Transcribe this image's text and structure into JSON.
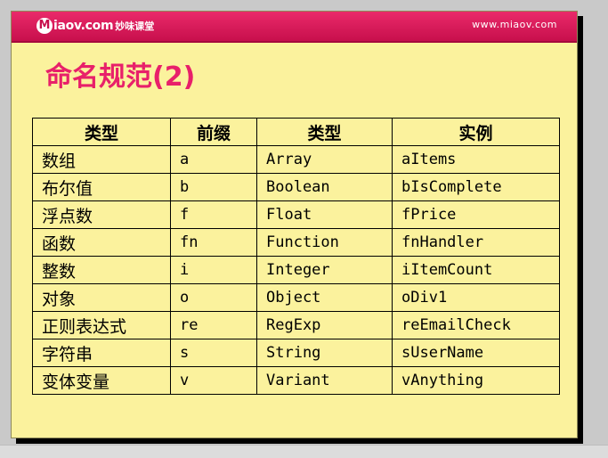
{
  "header": {
    "logo_badge": "M",
    "logo_text": "iaov.com",
    "logo_cn": "妙味课堂",
    "site_url": "www.miaov.com"
  },
  "slide": {
    "title": "命名规范(2)"
  },
  "table": {
    "headers": [
      "类型",
      "前缀",
      "类型",
      "实例"
    ],
    "rows": [
      [
        "数组",
        "a",
        "Array",
        "aItems"
      ],
      [
        "布尔值",
        "b",
        "Boolean",
        "bIsComplete"
      ],
      [
        "浮点数",
        "f",
        "Float",
        "fPrice"
      ],
      [
        "函数",
        "fn",
        "Function",
        "fnHandler"
      ],
      [
        "整数",
        "i",
        "Integer",
        "iItemCount"
      ],
      [
        "对象",
        "o",
        "Object",
        "oDiv1"
      ],
      [
        "正则表达式",
        "re",
        "RegExp",
        "reEmailCheck"
      ],
      [
        "字符串",
        "s",
        "String",
        "sUserName"
      ],
      [
        "变体变量",
        "v",
        "Variant",
        "vAnything"
      ]
    ]
  },
  "colors": {
    "header_bg": "#c70f4c",
    "title": "#e8206a",
    "slide_bg": "#fbf29d"
  }
}
